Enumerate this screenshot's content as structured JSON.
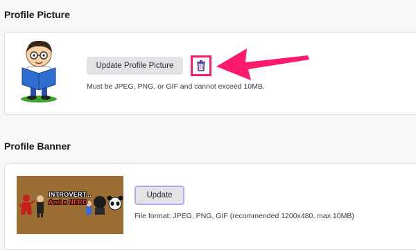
{
  "profile_picture": {
    "title": "Profile Picture",
    "update_label": "Update Profile Picture",
    "hint": "Must be JPEG, PNG, or GIF and cannot exceed 10MB."
  },
  "profile_banner": {
    "title": "Profile Banner",
    "update_label": "Update",
    "hint": "File format: JPEG, PNG, GIF (recommended 1200x480, max 10MB)",
    "image_text_line1": "INTROVERT...",
    "image_text_line2": "And a NERD"
  },
  "colors": {
    "highlight": "#ff1a6e",
    "trash_icon": "#6441a5",
    "focus_ring": "#b9a6f2",
    "banner_bg": "#9b6e34"
  },
  "icons": {
    "delete": "trash-icon",
    "annotation": "arrow-icon",
    "avatar": "nerd-cartoon-avatar"
  }
}
